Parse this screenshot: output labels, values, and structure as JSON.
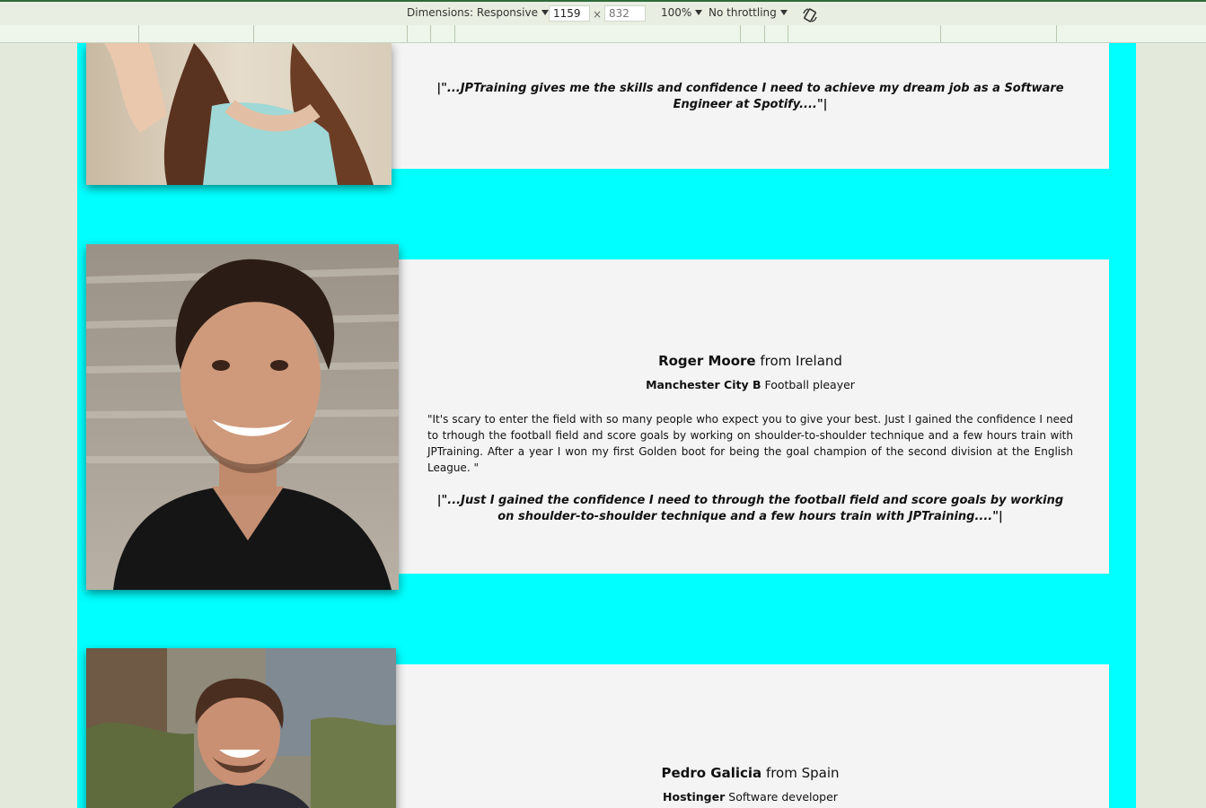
{
  "devtools": {
    "dimensions_label": "Dimensions: Responsive",
    "width_value": "1159",
    "times": "×",
    "height_placeholder": "832",
    "zoom": "100%",
    "throttling": "No throttling",
    "rotate_icon": "rotate-icon"
  },
  "colors": {
    "page_bg": "#00ffff",
    "card_bg": "#f4f4f4",
    "devtools_bg": "#e8eee1"
  },
  "testimonials": [
    {
      "name": "",
      "from": "",
      "company": "",
      "role": "",
      "body": "",
      "quote": "|\"...JPTraining gives me the skills and confidence I need to achieve my dream job as a Software Engineer at Spotify....\"|"
    },
    {
      "name": "Roger Moore",
      "from": "from Ireland",
      "company": "Manchester City B",
      "role": "Football pleayer",
      "body": "\"It's scary to enter the field with so many people who expect you to give your best. Just I gained the confidence I need to trhough the football field and score goals by working on shoulder-to-shoulder technique and a few hours train with JPTraining. After a year I won my first Golden boot for being the goal champion of the second division at the English League. \"",
      "quote": "|\"...Just I gained the confidence I need to through the football field and score goals by working on shoulder-to-shoulder technique and a few hours train with JPTraining....\"|"
    },
    {
      "name": "Pedro Galicia",
      "from": "from Spain",
      "company": "Hostinger",
      "role": "Software developer",
      "body": "",
      "quote": ""
    }
  ]
}
